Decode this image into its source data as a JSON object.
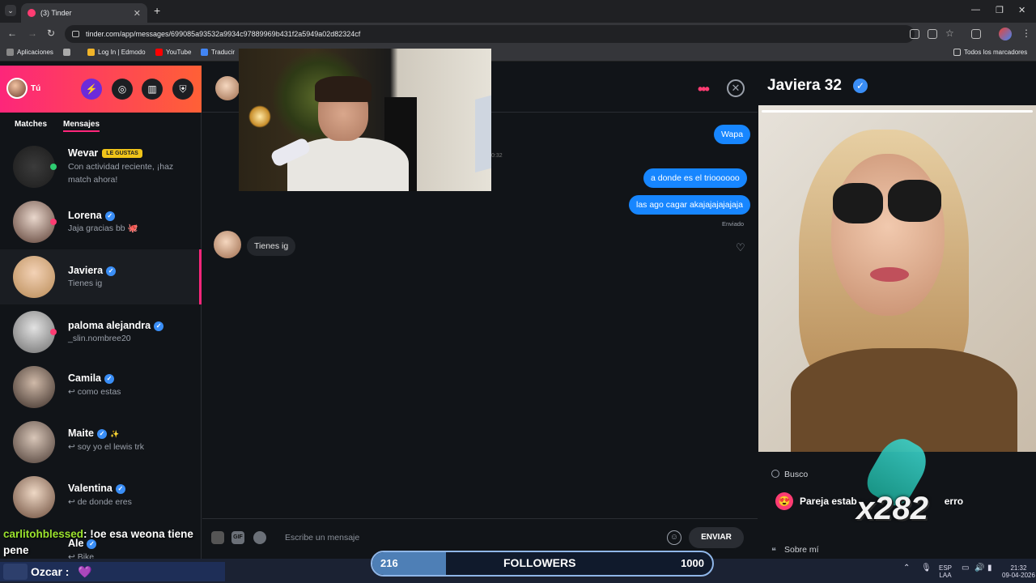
{
  "browser": {
    "tab_title": "(3) Tinder",
    "url": "tinder.com/app/messages/699085a93532a9934c97889969b431f2a5949a02d82324cf",
    "bookmarks": [
      "Aplicaciones",
      "Log In | Edmodo",
      "YouTube",
      "Traducir"
    ],
    "bookmarks_right": "Todos los marcadores"
  },
  "sidebar": {
    "me_label": "Tú",
    "tabs": [
      "Matches",
      "Mensajes"
    ],
    "active_tab": "Mensajes",
    "likes_badge": "LE GUSTAS",
    "conversations": [
      {
        "name": "Wevar",
        "message": "Con actividad reciente, ¡haz match ahora!",
        "verified": false
      },
      {
        "name": "Lorena",
        "message": "Jaja gracias bb 🐙",
        "verified": true
      },
      {
        "name": "Javiera",
        "message": "Tienes ig",
        "verified": true
      },
      {
        "name": "paloma alejandra",
        "message": "_slin.nombree20",
        "verified": true
      },
      {
        "name": "Camila",
        "message": "↩ como estas",
        "verified": true
      },
      {
        "name": "Maite",
        "message": "↩ soy yo el lewis trk",
        "verified": true
      },
      {
        "name": "Valentina",
        "message": "↩ de donde eres",
        "verified": true
      },
      {
        "name": "Ale",
        "message": "↩ Bike",
        "verified": true
      }
    ]
  },
  "chat": {
    "timestamp_fragment": "0:32",
    "messages_out": [
      "Wapa",
      "a donde es el trioooooo",
      "las ago cagar akajajajajajaja"
    ],
    "sent_label": "Enviado",
    "message_in": "Tienes ig",
    "composer_placeholder": "Escribe un mensaje",
    "gif_label": "GIF",
    "send_label": "ENVIAR"
  },
  "profile": {
    "name": "Javiera",
    "age": "32",
    "looking_for_label": "Busco",
    "looking_for_value_visible_left": "Pareja estab",
    "looking_for_value_visible_right": "erro",
    "about_label": "Sobre mí"
  },
  "stream": {
    "chat_user": "carlitohblessed",
    "chat_text": ": !oe esa weona tiene pene",
    "streamer": "Ozcar :",
    "gift_overlay": "x282",
    "followers_current": "216",
    "followers_label": "FOLLOWERS",
    "followers_goal": "1000",
    "followers_progress": 0.216,
    "tray_lang": "ESP",
    "tray_lang2": "LAA",
    "clock_time": "21:32",
    "clock_date": "09-04-2026"
  },
  "colors": {
    "tinder_pink": "#fe3c72",
    "bubble_blue": "#1786ff",
    "verified_blue": "#3a8ef6",
    "chat_user_green": "#9be22d"
  }
}
